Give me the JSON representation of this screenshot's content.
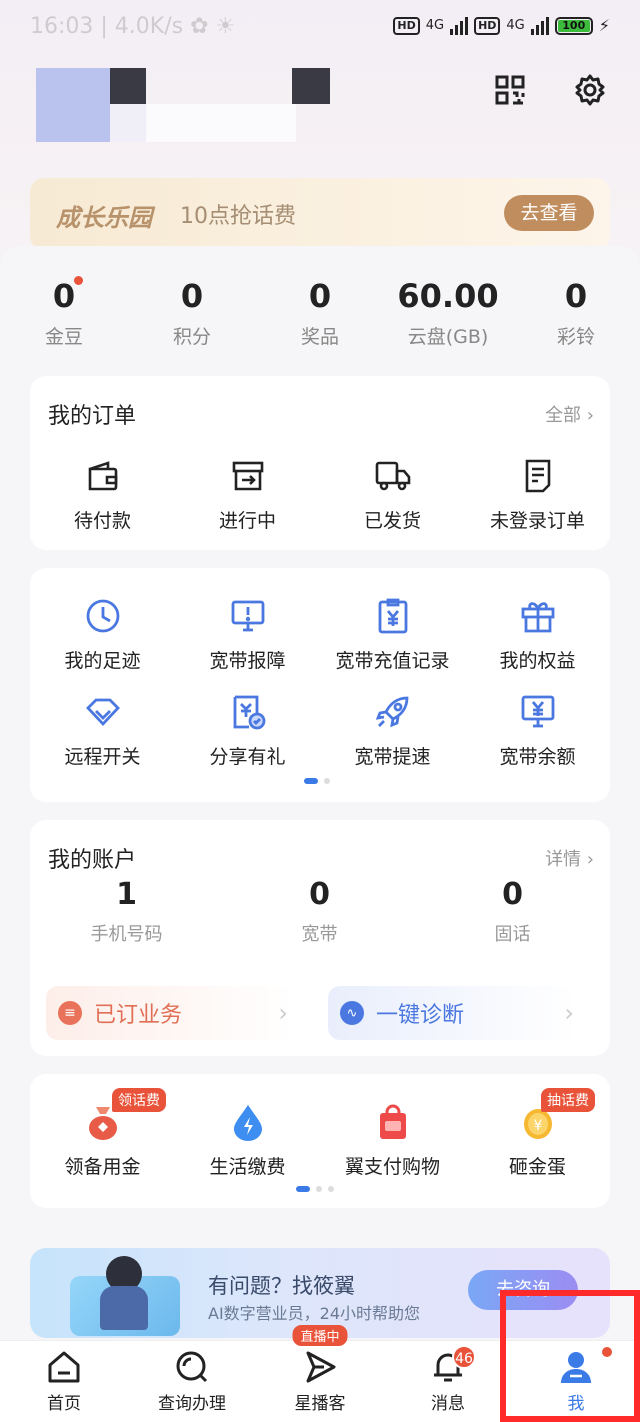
{
  "status_bar": {
    "time": "16:03 | 4.0K/s ✿ ☀",
    "signal_label": "4G",
    "battery": "100"
  },
  "header": {
    "qr_icon": "qr-code-icon",
    "settings_icon": "gear-icon"
  },
  "banner": {
    "title": "成长乐园",
    "subtitle": "10点抢话费",
    "button": "去查看"
  },
  "stats": [
    {
      "value": "0",
      "label": "金豆",
      "dot": true
    },
    {
      "value": "0",
      "label": "积分"
    },
    {
      "value": "0",
      "label": "奖品"
    },
    {
      "value": "60.00",
      "label": "云盘(GB)"
    },
    {
      "value": "0",
      "label": "彩铃"
    }
  ],
  "orders": {
    "title": "我的订单",
    "more": "全部",
    "items": [
      {
        "label": "待付款",
        "icon": "wallet-icon"
      },
      {
        "label": "进行中",
        "icon": "box-icon"
      },
      {
        "label": "已发货",
        "icon": "truck-icon"
      },
      {
        "label": "未登录订单",
        "icon": "document-icon"
      }
    ]
  },
  "services": {
    "row1": [
      {
        "label": "我的足迹",
        "icon": "clock-icon"
      },
      {
        "label": "宽带报障",
        "icon": "monitor-alert-icon"
      },
      {
        "label": "宽带充值记录",
        "icon": "yen-clipboard-icon"
      },
      {
        "label": "我的权益",
        "icon": "gift-icon"
      }
    ],
    "row2": [
      {
        "label": "远程开关",
        "icon": "diamond-icon"
      },
      {
        "label": "分享有礼",
        "icon": "share-gift-icon"
      },
      {
        "label": "宽带提速",
        "icon": "rocket-icon"
      },
      {
        "label": "宽带余额",
        "icon": "yen-monitor-icon"
      }
    ]
  },
  "account": {
    "title": "我的账户",
    "more": "详情",
    "items": [
      {
        "value": "1",
        "label": "手机号码"
      },
      {
        "value": "0",
        "label": "宽带"
      },
      {
        "value": "0",
        "label": "固话"
      }
    ],
    "subscribed": "已订业务",
    "diagnose": "一键诊断"
  },
  "promos": {
    "items": [
      {
        "label": "领备用金",
        "tag": "领话费",
        "icon": "money-bag-icon"
      },
      {
        "label": "生活缴费",
        "tag": "",
        "icon": "lightning-drop-icon"
      },
      {
        "label": "翼支付购物",
        "tag": "",
        "icon": "shopping-bag-icon"
      },
      {
        "label": "砸金蛋",
        "tag": "抽话费",
        "icon": "golden-egg-icon"
      }
    ]
  },
  "ai_banner": {
    "title": "有问题？找筱翼",
    "subtitle": "AI数字营业员，24小时帮助您",
    "button": "去咨询"
  },
  "tabbar": {
    "items": [
      {
        "label": "首页",
        "icon": "home-icon"
      },
      {
        "label": "查询办理",
        "icon": "search-query-icon"
      },
      {
        "label": "星播客",
        "icon": "play-arrow-icon",
        "live": "直播中"
      },
      {
        "label": "消息",
        "icon": "bell-icon",
        "count": "46"
      },
      {
        "label": "我",
        "icon": "person-icon",
        "active": true
      }
    ]
  },
  "colors": {
    "accent": "#3b7be8",
    "alert": "#e8533a",
    "highlight_box": "#ff2a2a"
  }
}
